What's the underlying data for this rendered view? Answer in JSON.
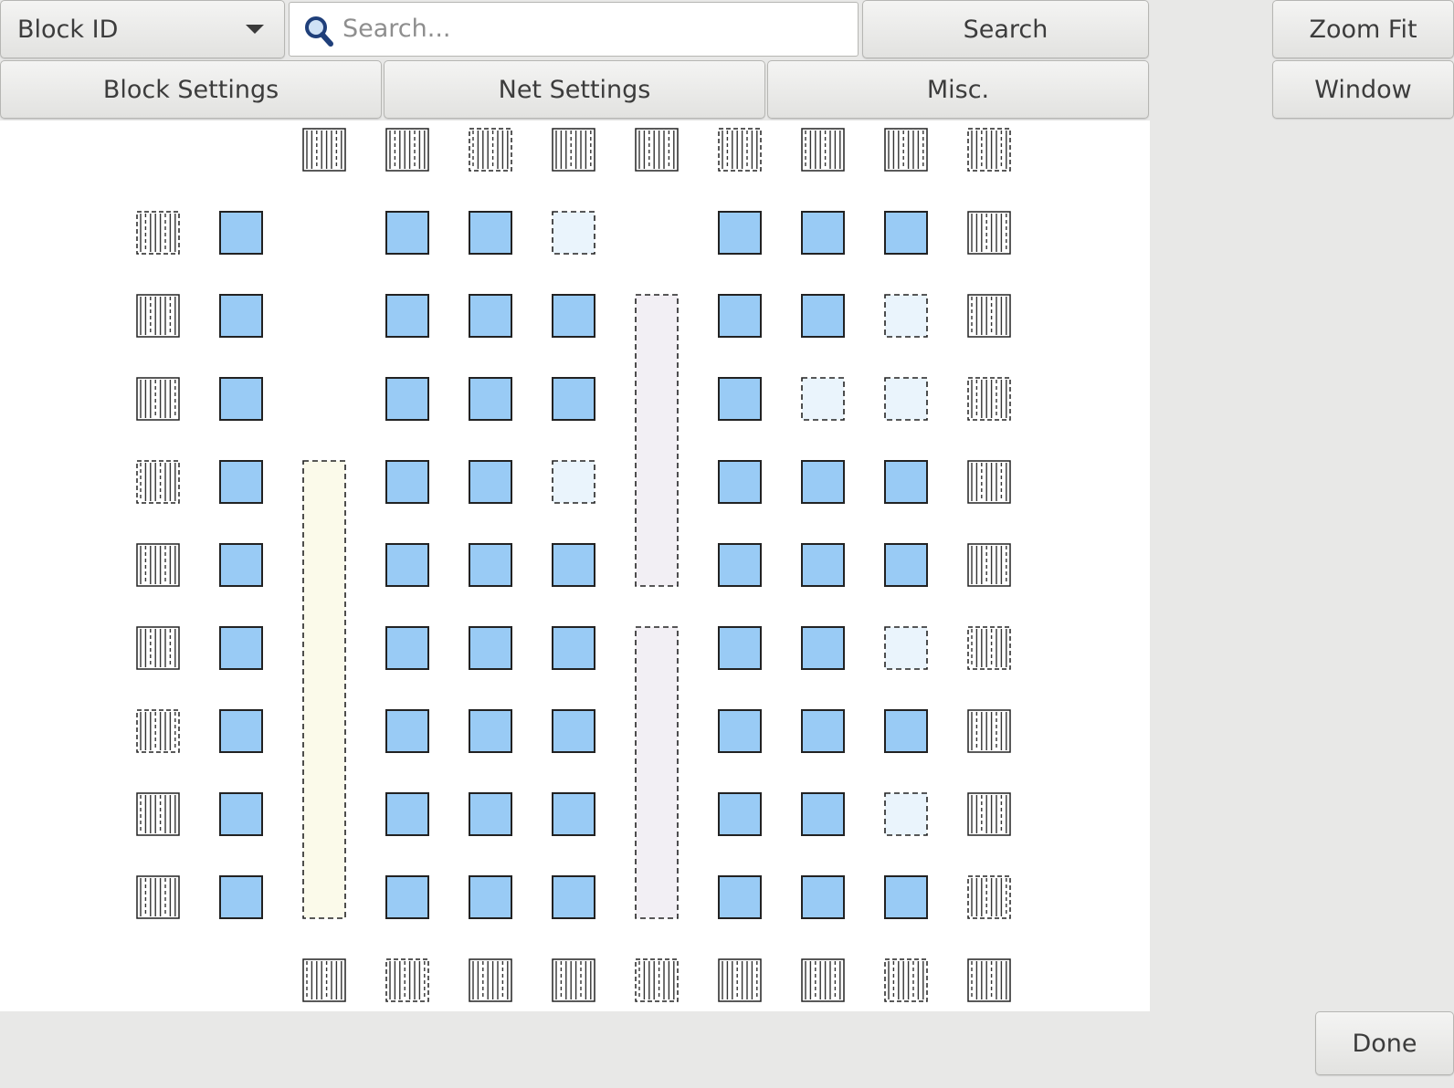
{
  "toolbar": {
    "block_select": {
      "selected": "Block ID"
    },
    "search": {
      "placeholder": "Search...",
      "icon": "search-icon"
    },
    "search_button": "Search",
    "zoom_fit_button": "Zoom Fit",
    "window_button": "Window",
    "tabs": [
      "Block Settings",
      "Net Settings",
      "Misc."
    ]
  },
  "footer": {
    "done_button": "Done"
  },
  "fpga_grid": {
    "rows": 11,
    "cols": 11,
    "legend_cell_types": {
      "clb": "solid blue logic block",
      "empty": "dashed, light blue (unused logic block)",
      "io": "hatched I/O pad",
      "mult": "dashed tall macro (pale yellow)",
      "mem": "dashed tall macro (pale lavender)"
    },
    "cells": [
      "  IIIIIIIII ",
      "IC CCE CCCI",
      "IC CCCMCCEI",
      "IC CCCMCEEI",
      "ICYCCEMCCCI",
      "ICYCCCMCCCI",
      "ICYCCCNCCEI",
      "ICYCCCNCCCI",
      "ICYCCCNCCEI",
      "ICYCCCNCCCI",
      "  IIIIIIIII "
    ],
    "colors": {
      "clb_fill": "#99cbf5",
      "empty_fill": "#eaf4fc",
      "mult_fill": "#fbfaea",
      "mem_fill": "#f2eff4",
      "io_fill": "#c8c8c8",
      "outline": "#222222"
    }
  }
}
